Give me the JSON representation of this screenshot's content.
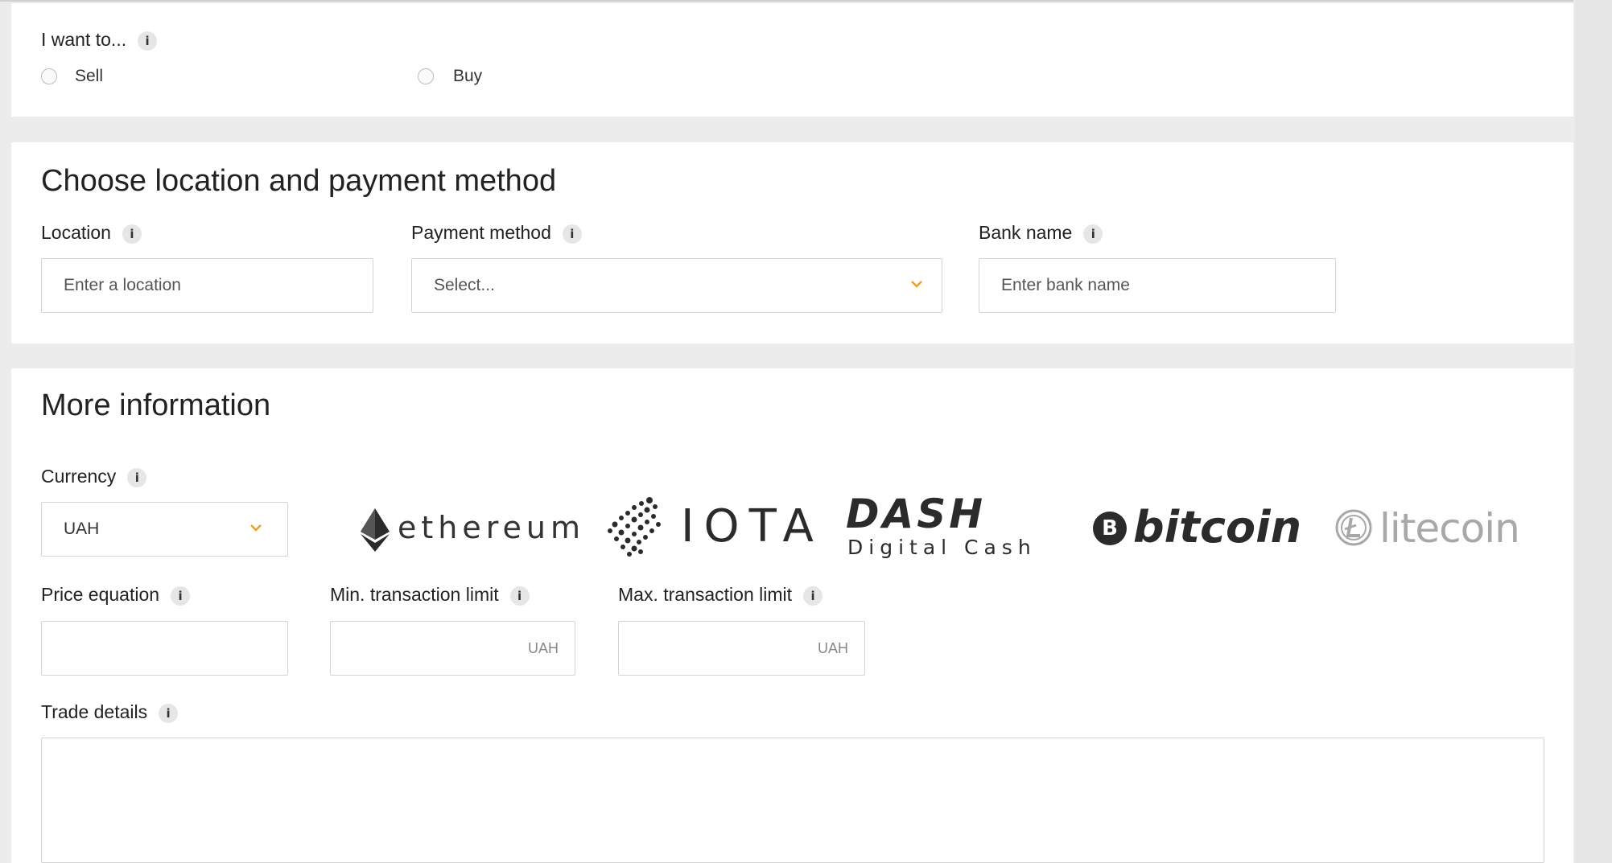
{
  "intent": {
    "label": "I want to...",
    "info": "i",
    "options": [
      {
        "label": "Sell"
      },
      {
        "label": "Buy"
      }
    ]
  },
  "location_section": {
    "heading": "Choose location and payment method",
    "location": {
      "label": "Location",
      "info": "i",
      "placeholder": "Enter a location"
    },
    "payment": {
      "label": "Payment method",
      "info": "i",
      "value": "Select..."
    },
    "bank": {
      "label": "Bank name",
      "info": "i",
      "placeholder": "Enter bank name"
    }
  },
  "more_section": {
    "heading": "More information",
    "currency": {
      "label": "Currency",
      "info": "i",
      "value": "UAH"
    },
    "logos": {
      "ethereum": "ethereum",
      "iota": "IOTA",
      "dash_title": "DASH",
      "dash_sub": "Digital Cash",
      "bitcoin": "bitcoin",
      "bitcoin_mark": "B",
      "litecoin": "litecoin"
    },
    "price": {
      "label": "Price equation",
      "info": "i",
      "value": ""
    },
    "min": {
      "label": "Min. transaction limit",
      "info": "i",
      "suffix": "UAH"
    },
    "max": {
      "label": "Max. transaction limit",
      "info": "i",
      "suffix": "UAH"
    },
    "details": {
      "label": "Trade details",
      "info": "i",
      "value": ""
    }
  },
  "colors": {
    "accent": "#f0a020",
    "logo_dark": "#2b2b2b",
    "logo_light": "#a8a8a8"
  }
}
